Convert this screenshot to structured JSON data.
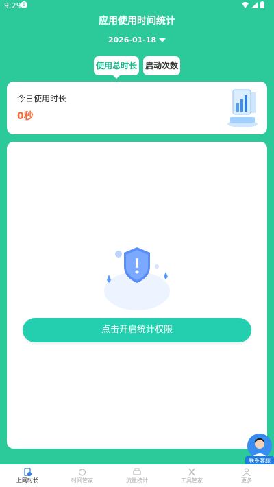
{
  "status": {
    "time": "9:29"
  },
  "header": {
    "title": "应用使用时间统计",
    "date": "2026-01-18"
  },
  "tabs": [
    {
      "label": "使用总时长",
      "active": true
    },
    {
      "label": "启动次数",
      "active": false
    }
  ],
  "summary": {
    "label": "今日使用时长",
    "value": "0秒"
  },
  "permission": {
    "button": "点击开启统计权限"
  },
  "service": {
    "label": "联系客服"
  },
  "nav": [
    {
      "label": "上网时长",
      "icon": "phone-clock-icon",
      "active": true
    },
    {
      "label": "时间管家",
      "icon": "alarm-icon",
      "active": false
    },
    {
      "label": "流量统计",
      "icon": "printer-icon",
      "active": false
    },
    {
      "label": "工具管家",
      "icon": "tools-icon",
      "active": false
    },
    {
      "label": "更多",
      "icon": "person-icon",
      "active": false
    }
  ],
  "colors": {
    "primary": "#2cc99a",
    "button": "#24cfb0",
    "accent_value": "#f26b3a"
  }
}
